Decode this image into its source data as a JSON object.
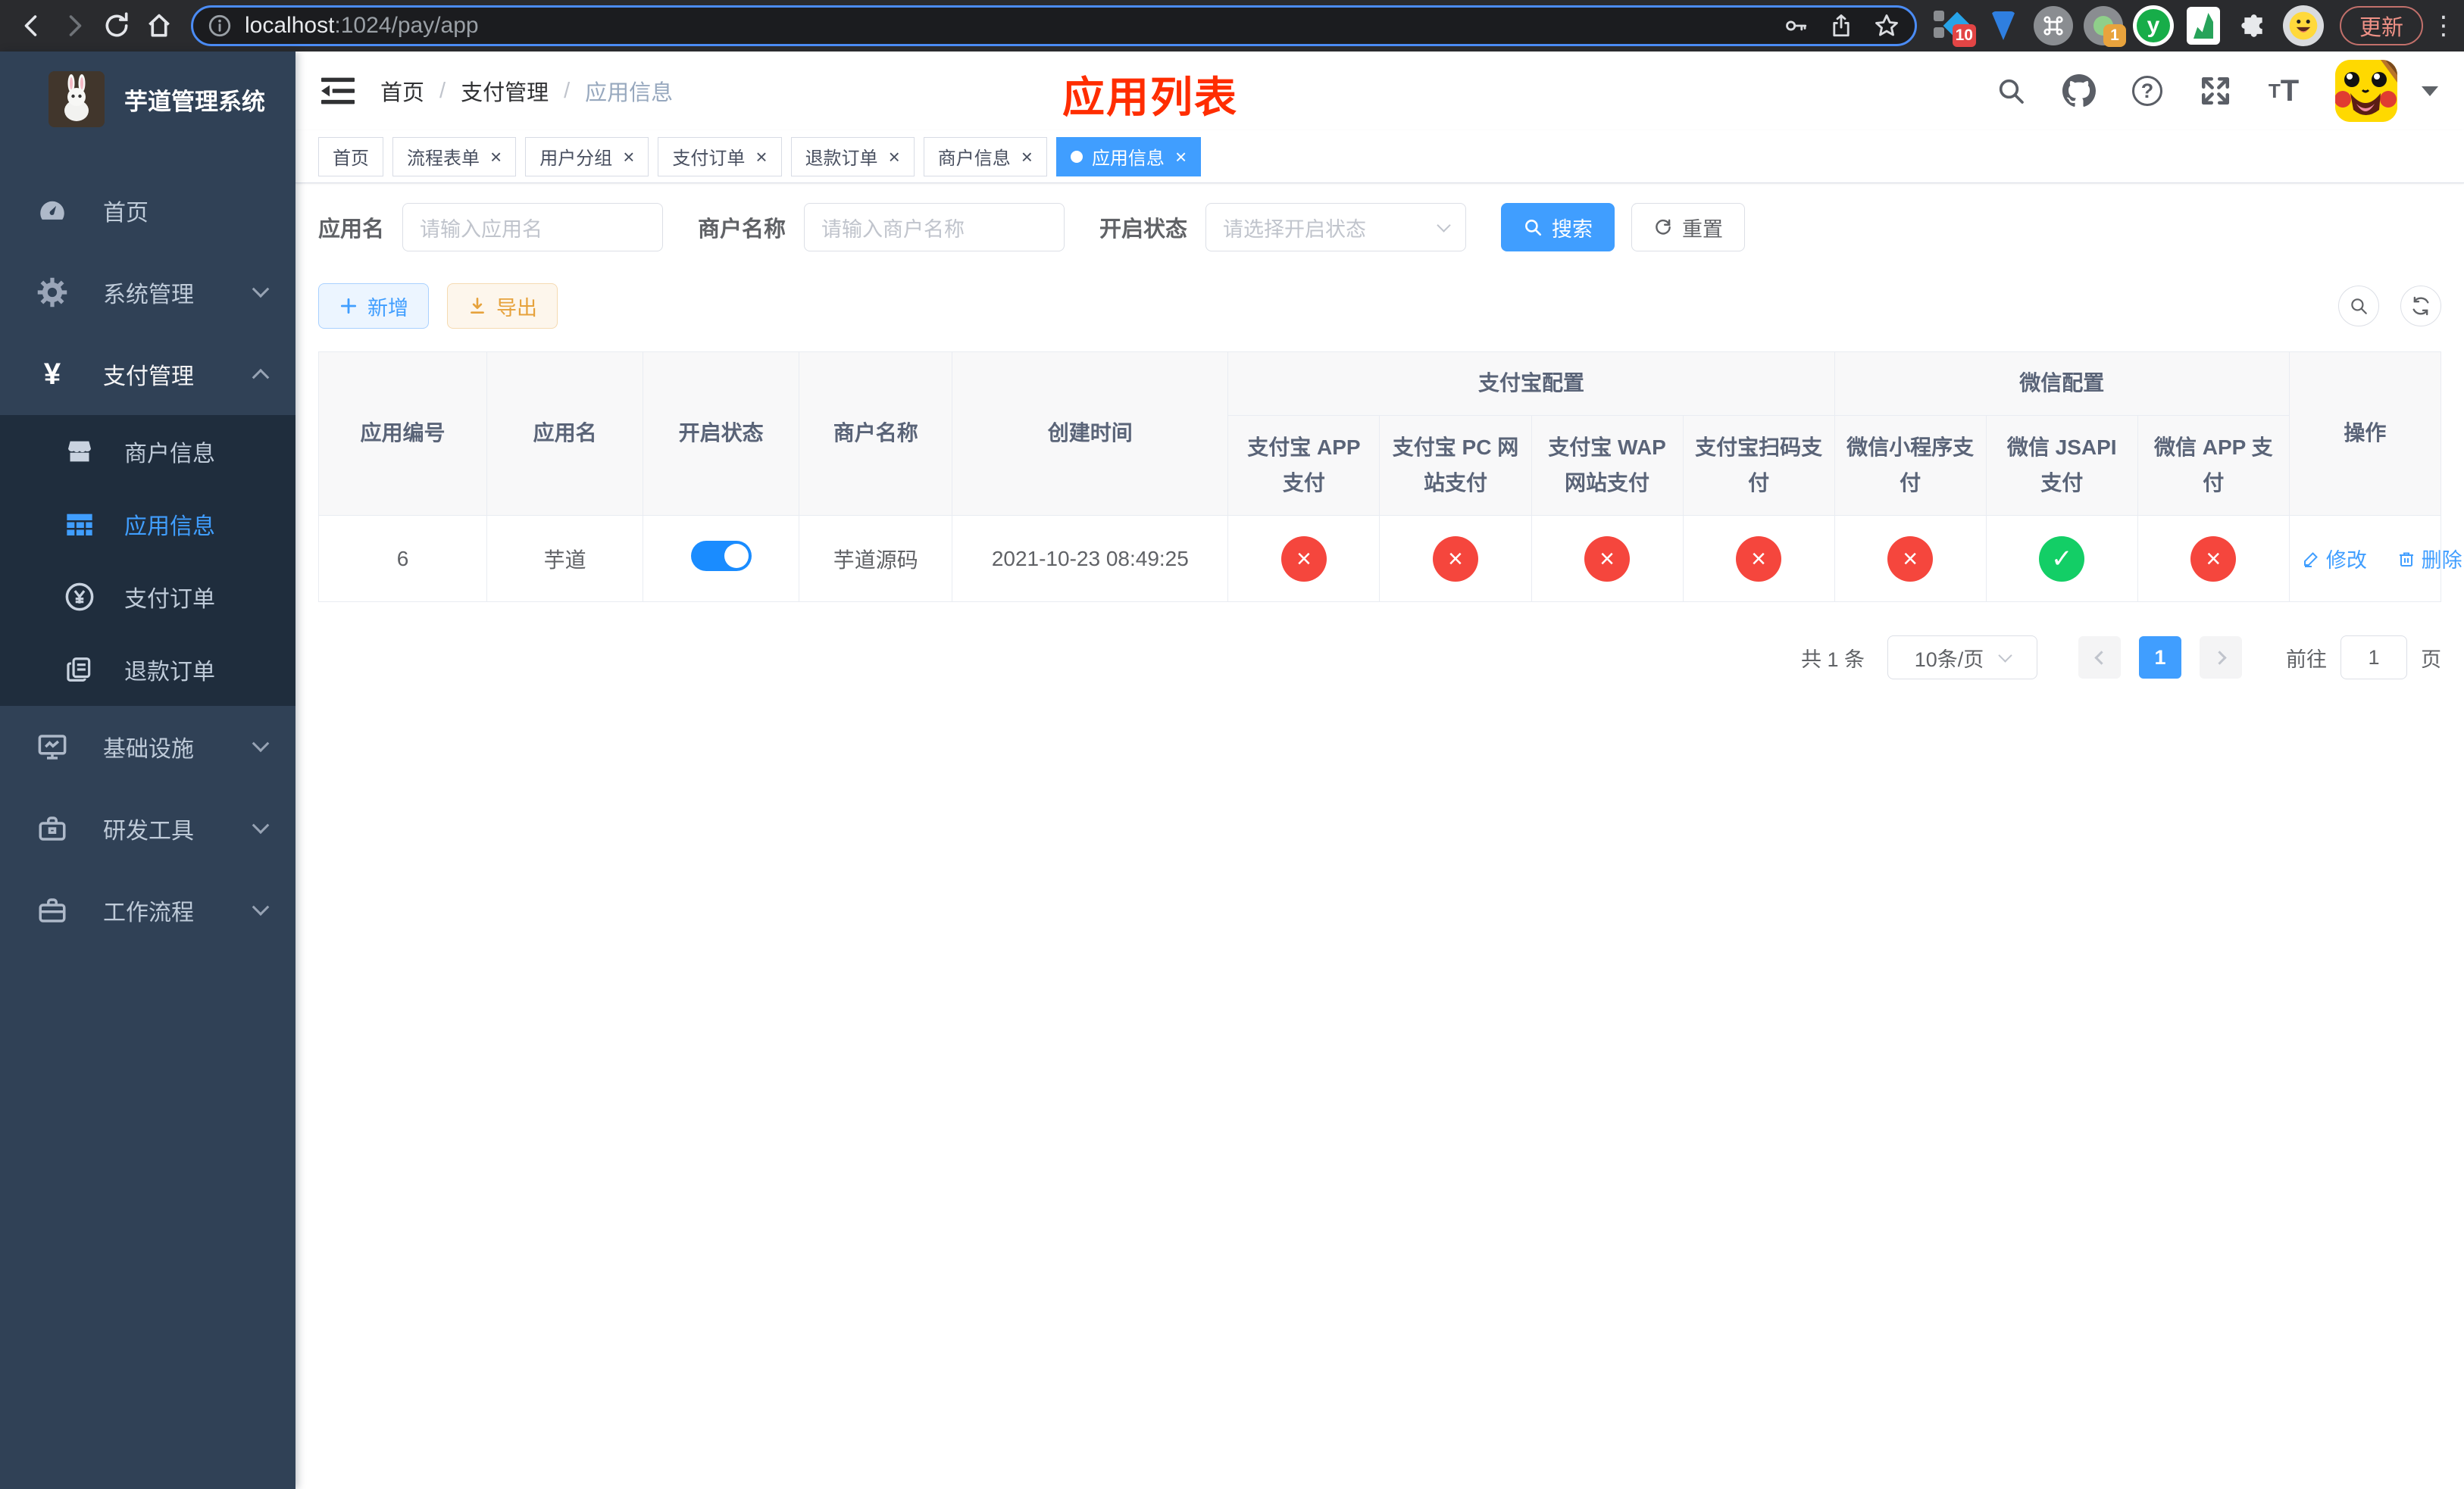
{
  "browser": {
    "url_host": "localhost",
    "url_path": ":1024/pay/app",
    "update_label": "更新",
    "ext_badge_1": "10",
    "ext_badge_2": "1",
    "ext_letter": "y"
  },
  "icons": {
    "fail_glyph": "×",
    "ok_glyph": "✓",
    "question_glyph": "?",
    "command_glyph": "⌘",
    "font_size_small": "T",
    "font_size_big": "T",
    "yen_glyph": "¥"
  },
  "sidebar": {
    "logo_title": "芋道管理系统",
    "items": [
      {
        "label": "首页"
      },
      {
        "label": "系统管理"
      },
      {
        "label": "支付管理"
      },
      {
        "label": "商户信息"
      },
      {
        "label": "应用信息"
      },
      {
        "label": "支付订单"
      },
      {
        "label": "退款订单"
      },
      {
        "label": "基础设施"
      },
      {
        "label": "研发工具"
      },
      {
        "label": "工作流程"
      }
    ]
  },
  "header": {
    "breadcrumb": [
      {
        "label": "首页"
      },
      {
        "label": "支付管理"
      },
      {
        "label": "应用信息"
      }
    ],
    "overlay_title": "应用列表"
  },
  "tabs": [
    {
      "label": "首页",
      "closable": false,
      "active": false
    },
    {
      "label": "流程表单",
      "closable": true,
      "active": false
    },
    {
      "label": "用户分组",
      "closable": true,
      "active": false
    },
    {
      "label": "支付订单",
      "closable": true,
      "active": false
    },
    {
      "label": "退款订单",
      "closable": true,
      "active": false
    },
    {
      "label": "商户信息",
      "closable": true,
      "active": false
    },
    {
      "label": "应用信息",
      "closable": true,
      "active": true
    }
  ],
  "filters": {
    "app_name_label": "应用名",
    "app_name_placeholder": "请输入应用名",
    "merchant_label": "商户名称",
    "merchant_placeholder": "请输入商户名称",
    "status_label": "开启状态",
    "status_placeholder": "请选择开启状态",
    "search_label": "搜索",
    "reset_label": "重置"
  },
  "actions": {
    "add_label": "新增",
    "export_label": "导出"
  },
  "table": {
    "columns": [
      "应用编号",
      "应用名",
      "开启状态",
      "商户名称",
      "创建时间"
    ],
    "group_alipay": "支付宝配置",
    "group_wechat": "微信配置",
    "alipay_columns": [
      "支付宝 APP 支付",
      "支付宝 PC 网站支付",
      "支付宝 WAP 网站支付",
      "支付宝扫码支付"
    ],
    "wechat_columns": [
      "微信小程序支付",
      "微信 JSAPI 支付",
      "微信 APP 支付"
    ],
    "ops_column": "操作",
    "row": {
      "id": "6",
      "name": "芋道",
      "enabled": true,
      "merchant": "芋道源码",
      "created_at": "2021-10-23 08:49:25",
      "pay_channels": [
        false,
        false,
        false,
        false,
        false,
        true,
        false
      ],
      "edit_label": "修改",
      "delete_label": "删除"
    }
  },
  "pagination": {
    "total_label": "共 1 条",
    "page_size_label": "10条/页",
    "current_page": "1",
    "goto_label": "前往",
    "goto_value": "1",
    "page_unit": "页"
  }
}
